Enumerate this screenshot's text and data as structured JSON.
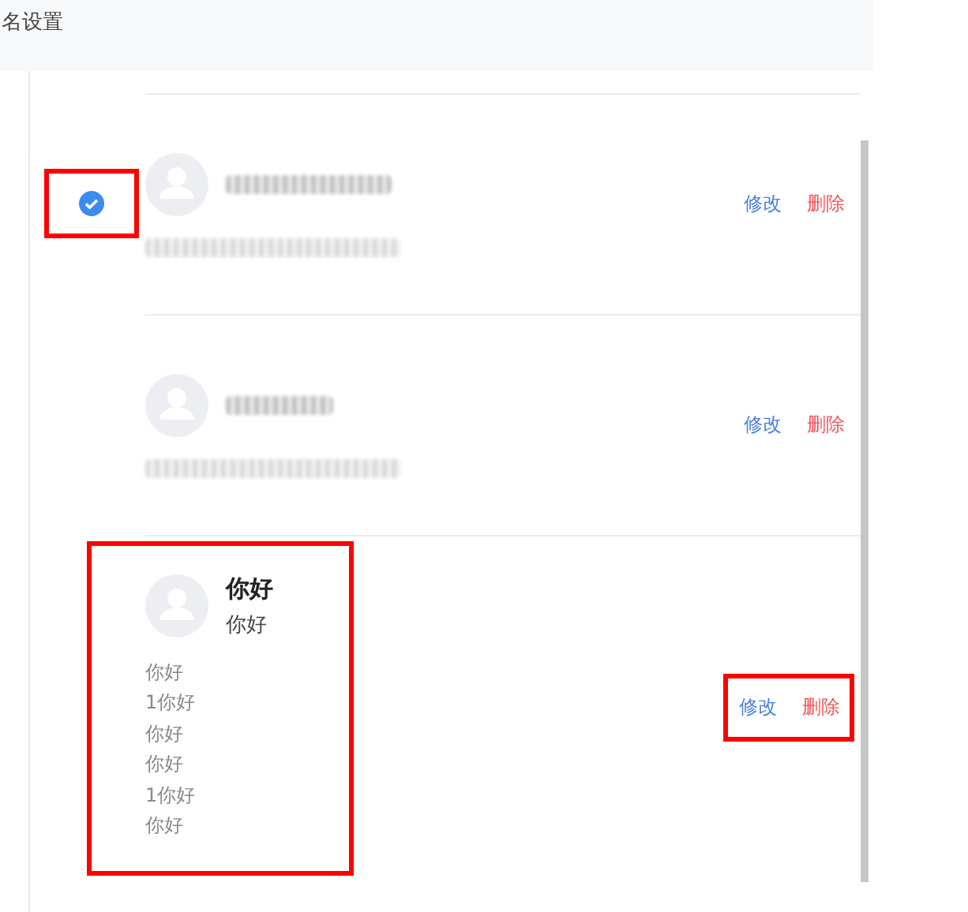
{
  "page_title": "名设置",
  "signatures": [
    {
      "kind": "redacted",
      "selected": true,
      "check_highlighted": true,
      "content_highlighted": false,
      "actions_highlighted": false,
      "actions": [
        {
          "kind": "edit",
          "label": "修改"
        },
        {
          "kind": "delete",
          "label": "删除"
        }
      ]
    },
    {
      "kind": "redacted",
      "selected": false,
      "check_highlighted": false,
      "content_highlighted": false,
      "actions_highlighted": false,
      "actions": [
        {
          "kind": "edit",
          "label": "修改"
        },
        {
          "kind": "delete",
          "label": "删除"
        }
      ]
    },
    {
      "kind": "text",
      "selected": false,
      "check_highlighted": false,
      "content_highlighted": true,
      "actions_highlighted": true,
      "name": "你好",
      "subtitle": "你好",
      "lines": [
        "你好",
        "1你好",
        "你好",
        "你好",
        "1你好",
        "你好"
      ],
      "actions": [
        {
          "kind": "edit",
          "label": "修改"
        },
        {
          "kind": "delete",
          "label": "删除"
        }
      ]
    }
  ]
}
